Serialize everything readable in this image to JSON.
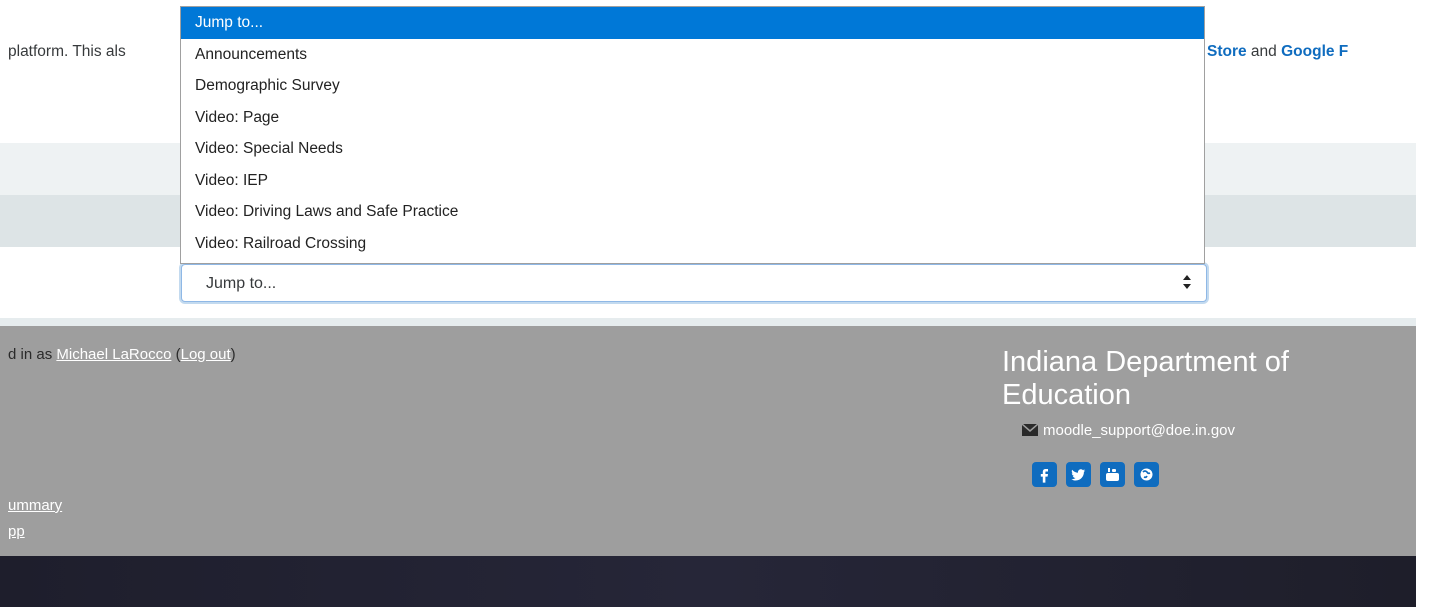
{
  "intro": {
    "left_text": "platform. This als",
    "right_prefix": "",
    "right_link1": "Store",
    "right_mid": " and ",
    "right_link2": "Google F"
  },
  "jump_select": {
    "value": "Jump to...",
    "arrow": "⬍"
  },
  "dropdown": {
    "items": [
      "Jump to...",
      "Announcements",
      "Demographic Survey",
      "Video: Page",
      "Video: Special Needs",
      "Video: IEP",
      "Video: Driving Laws and Safe Practice",
      "Video: Railroad Crossing"
    ],
    "selected_index": 0
  },
  "footer": {
    "login_prefix": "d in as ",
    "user_name": "Michael LaRocco",
    "login_open": " (",
    "logout_label": "Log out",
    "login_close": ")",
    "link1": "ummary",
    "link2": "pp",
    "org_name": "Indiana Department of Education",
    "email": "moodle_support@doe.in.gov",
    "socials": [
      {
        "name": "facebook-icon",
        "glyph": "f"
      },
      {
        "name": "twitter-icon",
        "glyph": "t"
      },
      {
        "name": "youtube-icon",
        "glyph": "▶"
      },
      {
        "name": "globe-icon",
        "glyph": "◉"
      }
    ]
  },
  "colors": {
    "accent": "#0f6cbf",
    "selection": "#0078d7",
    "footer_bg": "#9e9e9e"
  }
}
